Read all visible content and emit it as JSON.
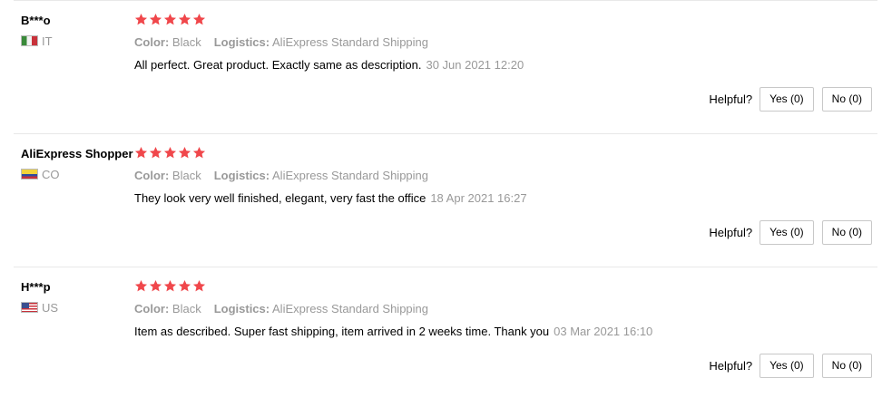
{
  "labels": {
    "color_key": "Color:",
    "logistics_key": "Logistics:",
    "helpful": "Helpful?"
  },
  "colors": {
    "star": "#f0474b",
    "muted_text": "#999999",
    "separator": "#e8e8e8"
  },
  "reviews": [
    {
      "user": "B***o",
      "country_code": "IT",
      "flag_icon": "italy-flag-icon",
      "rating": 5,
      "color": "Black",
      "logistics": "AliExpress Standard Shipping",
      "text": "All perfect. Great product. Exactly same as description.",
      "date": "30 Jun 2021 12:20",
      "yes_label": "Yes (0)",
      "no_label": "No (0)"
    },
    {
      "user": "AliExpress Shopper",
      "country_code": "CO",
      "flag_icon": "colombia-flag-icon",
      "rating": 5,
      "color": "Black",
      "logistics": "AliExpress Standard Shipping",
      "text": "They look very well finished, elegant, very fast the office",
      "date": "18 Apr 2021 16:27",
      "yes_label": "Yes (0)",
      "no_label": "No (0)"
    },
    {
      "user": "H***p",
      "country_code": "US",
      "flag_icon": "usa-flag-icon",
      "rating": 5,
      "color": "Black",
      "logistics": "AliExpress Standard Shipping",
      "text": "Item as described. Super fast shipping, item arrived in 2 weeks time. Thank you",
      "date": "03 Mar 2021 16:10",
      "yes_label": "Yes (0)",
      "no_label": "No (0)"
    }
  ]
}
